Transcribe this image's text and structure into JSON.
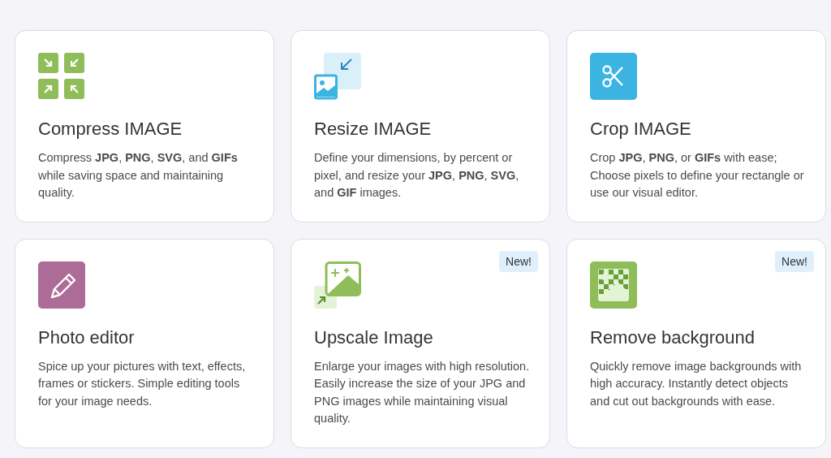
{
  "cards": [
    {
      "kind": "compress",
      "title": "Compress IMAGE",
      "description": "Compress **JPG**, **PNG**, **SVG**, and **GIFs** while saving space and maintaining quality."
    },
    {
      "kind": "resize",
      "title": "Resize IMAGE",
      "description": "Define your dimensions, by percent or pixel, and resize your **JPG**, **PNG**, **SVG**, and **GIF** images."
    },
    {
      "kind": "crop",
      "title": "Crop IMAGE",
      "description": "Crop **JPG**, **PNG**, or **GIFs** with ease; Choose pixels to define your rectangle or use our visual editor."
    },
    {
      "kind": "edit",
      "title": "Photo editor",
      "description": "Spice up your pictures with text, effects, frames or stickers. Simple editing tools for your image needs."
    },
    {
      "kind": "upscale",
      "title": "Upscale Image",
      "badge": "New!",
      "description": "Enlarge your images with high resolution. Easily increase the size of your JPG and PNG images while maintaining visual quality."
    },
    {
      "kind": "background",
      "title": "Remove background",
      "badge": "New!",
      "description": "Quickly remove image backgrounds with high accuracy. Instantly detect objects and cut out backgrounds with ease."
    }
  ]
}
